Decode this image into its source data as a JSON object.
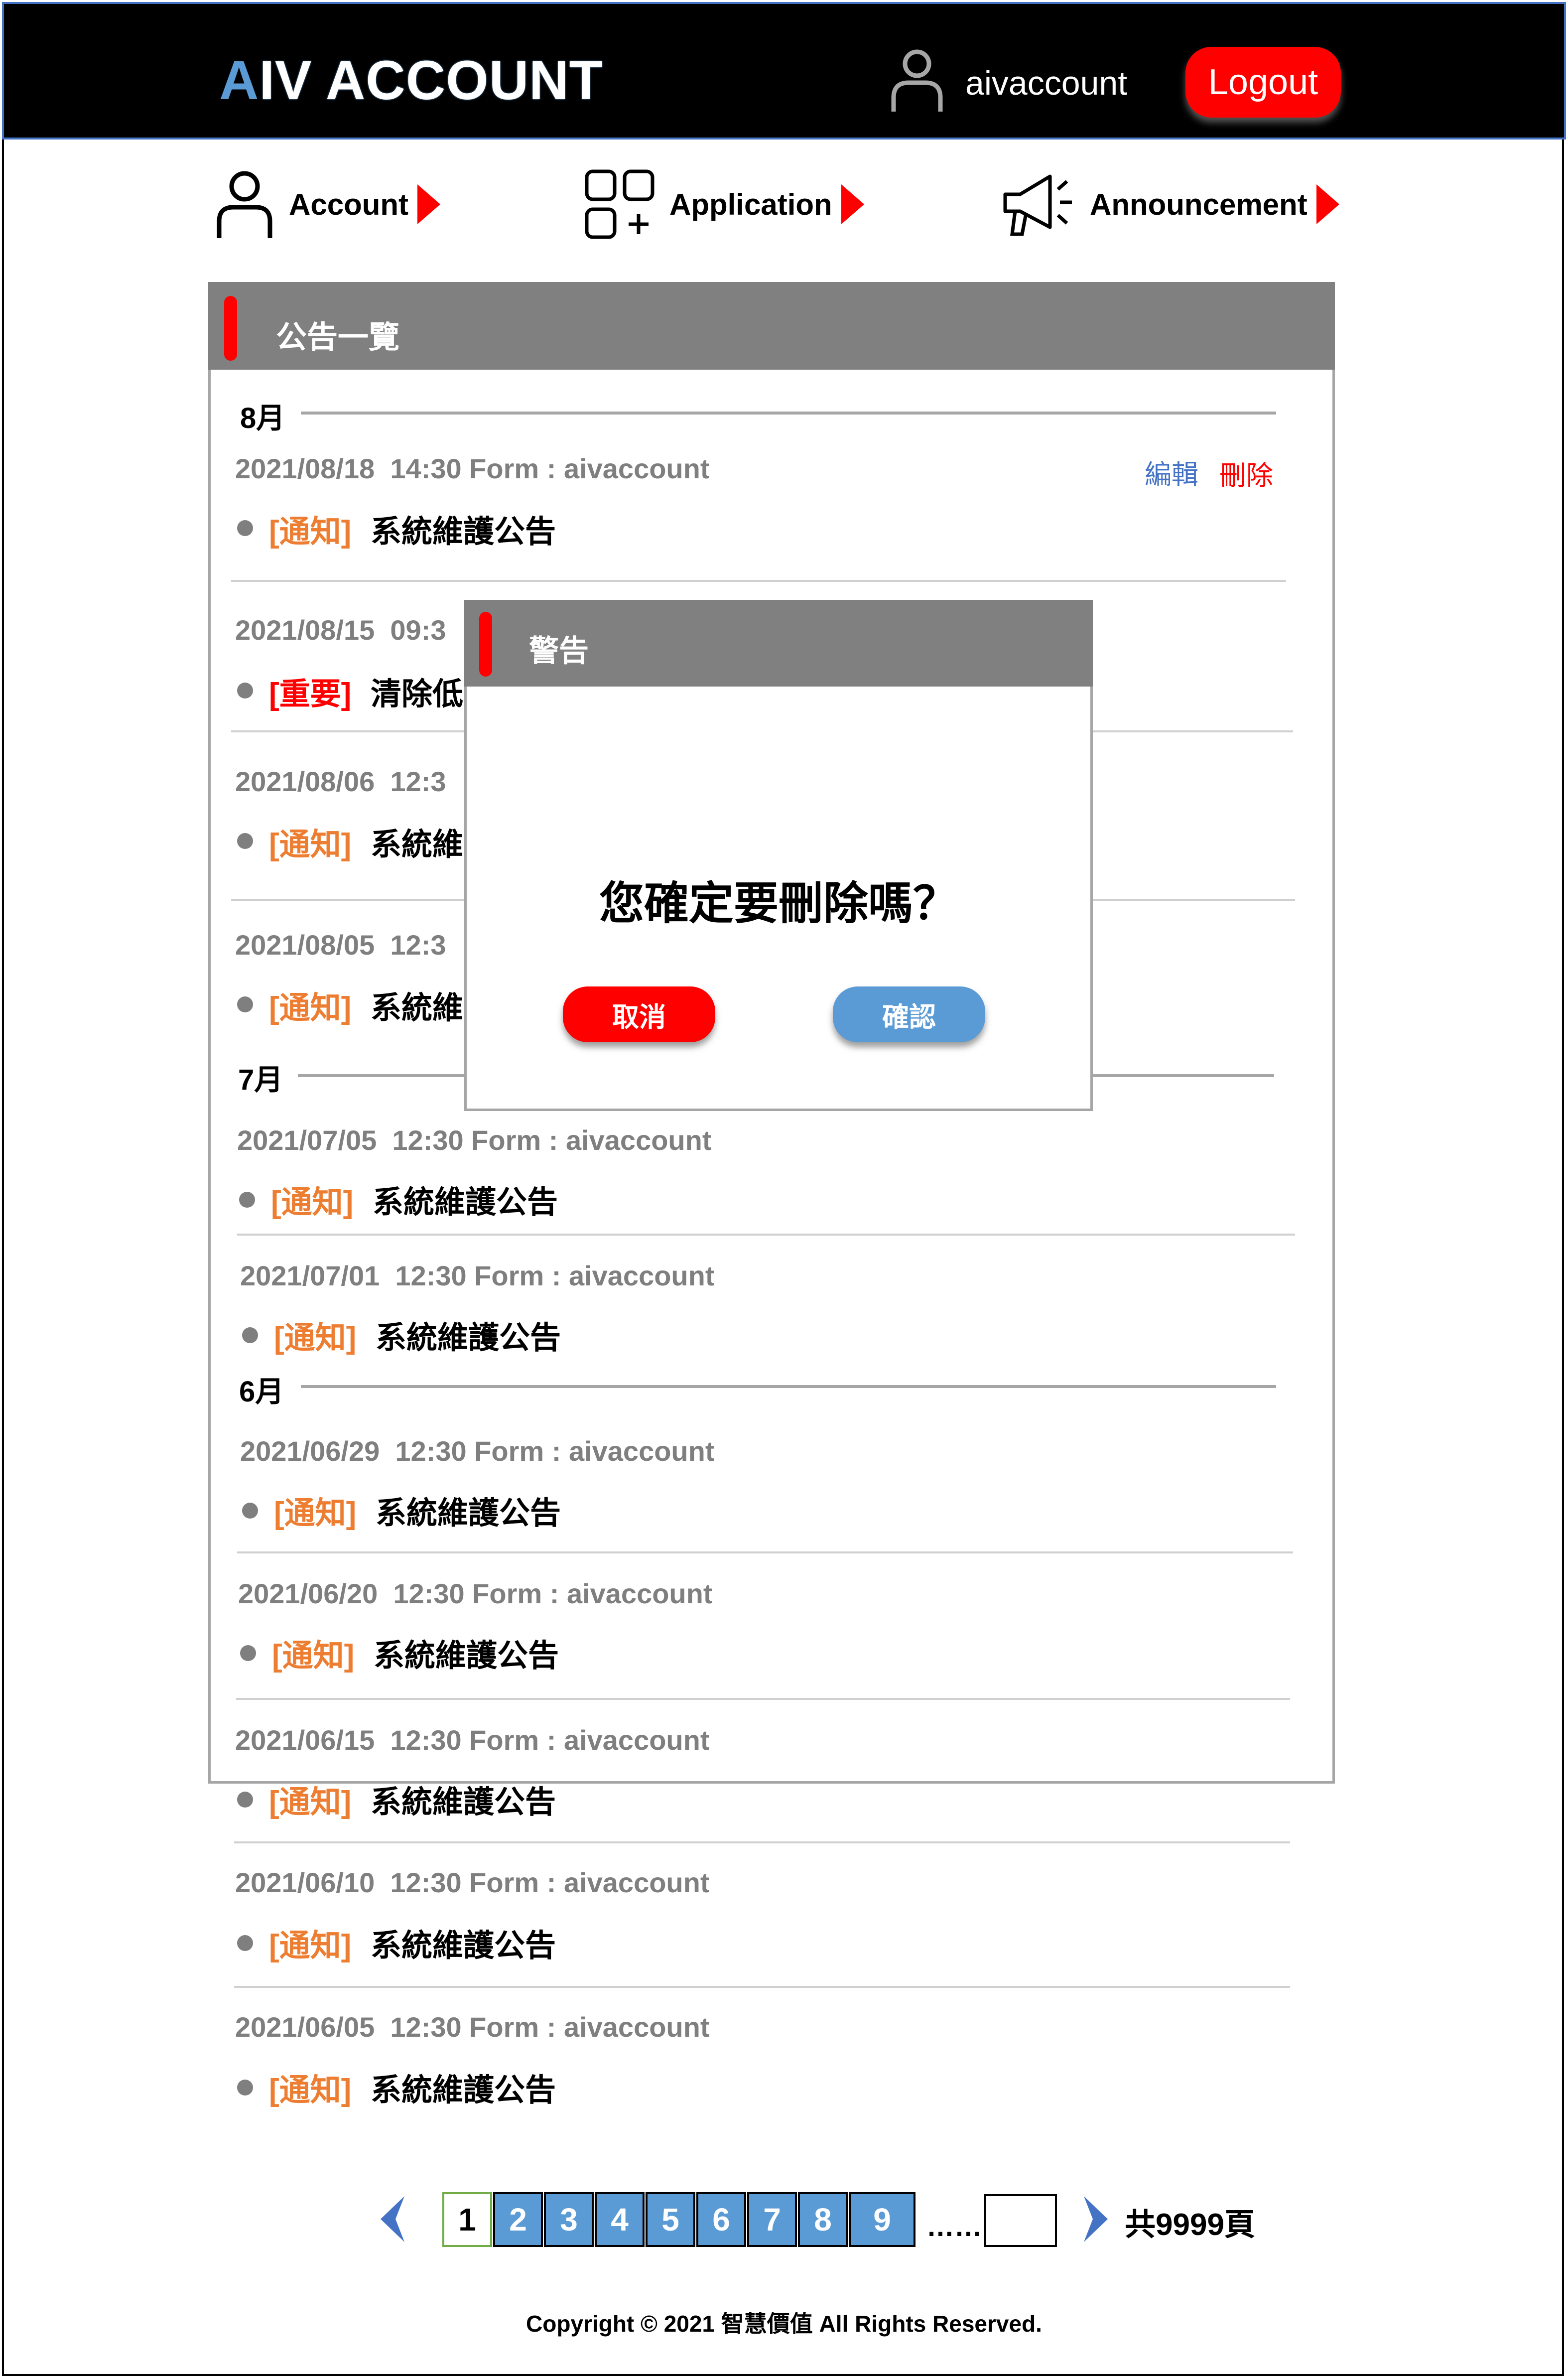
{
  "header": {
    "logo_first": "A",
    "logo_rest": "IV ACCOUNT",
    "username": "aivaccount",
    "logout_label": "Logout"
  },
  "nav": {
    "account": "Account",
    "application": "Application",
    "announcement": "Announcement"
  },
  "panel": {
    "title": "公告一覽"
  },
  "months": {
    "aug": "8月",
    "jul": "7月",
    "jun": "6月"
  },
  "actions": {
    "edit": "編輯",
    "delete": "刪除"
  },
  "announcements": [
    {
      "meta": "2021/08/18  14:30 Form : aivaccount",
      "tag": "[通知]",
      "title": "系統維護公告"
    },
    {
      "meta": "2021/08/15  09:3",
      "tag": "[重要]",
      "title": "清除低"
    },
    {
      "meta": "2021/08/06  12:3",
      "tag": "[通知]",
      "title": "系統維"
    },
    {
      "meta": "2021/08/05  12:3",
      "tag": "[通知]",
      "title": "系統維"
    },
    {
      "meta": "2021/07/05  12:30 Form : aivaccount",
      "tag": "[通知]",
      "title": "系統維護公告"
    },
    {
      "meta": "2021/07/01  12:30 Form : aivaccount",
      "tag": "[通知]",
      "title": "系統維護公告"
    },
    {
      "meta": "2021/06/29  12:30 Form : aivaccount",
      "tag": "[通知]",
      "title": "系統維護公告"
    },
    {
      "meta": "2021/06/20  12:30 Form : aivaccount",
      "tag": "[通知]",
      "title": "系統維護公告"
    },
    {
      "meta": "2021/06/15  12:30 Form : aivaccount",
      "tag": "[通知]",
      "title": "系統維護公告"
    },
    {
      "meta": "2021/06/10  12:30 Form : aivaccount",
      "tag": "[通知]",
      "title": "系統維護公告"
    },
    {
      "meta": "2021/06/05  12:30 Form : aivaccount",
      "tag": "[通知]",
      "title": "系統維護公告"
    }
  ],
  "modal": {
    "title": "警告",
    "message": "您確定要刪除嗎？",
    "cancel": "取消",
    "confirm": "確認"
  },
  "pagination": {
    "pages": [
      "1",
      "2",
      "3",
      "4",
      "5",
      "6",
      "7",
      "8",
      "9"
    ],
    "current": "1",
    "ellipsis": "……",
    "total": "共9999頁"
  },
  "footer": {
    "copyright": "Copyright © 2021 智慧價值 All Rights Reserved."
  },
  "colors": {
    "accent_red": "#ff0000",
    "accent_blue": "#5b9bd5",
    "tag_notice": "#ed7d31",
    "tag_important": "#ff0000",
    "edit_blue": "#4472c4",
    "header_bg": "#000000",
    "panel_header": "#808080"
  }
}
